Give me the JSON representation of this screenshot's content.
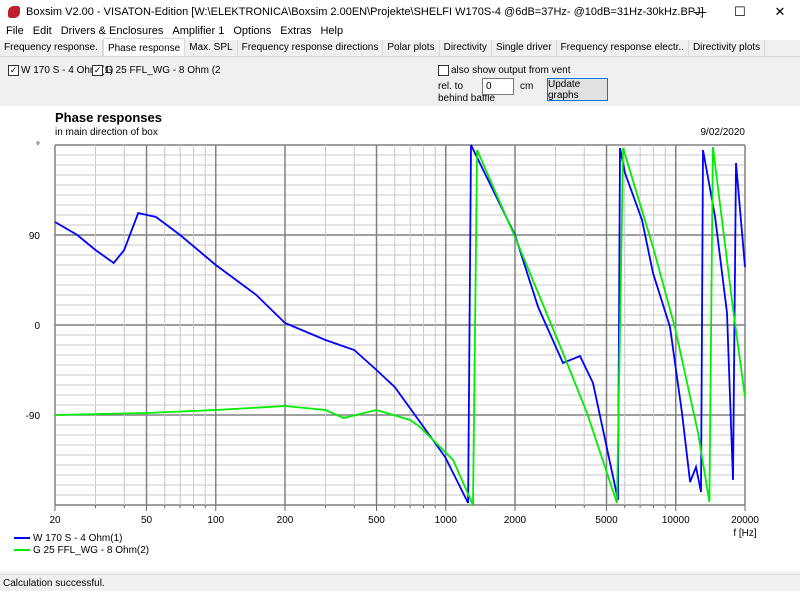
{
  "window": {
    "title": "Boxsim V2.00 - VISATON-Edition [W:\\ELEKTRONICA\\Boxsim 2.00EN\\Projekte\\SHELFI W170S-4 @6dB=37Hz- @10dB=31Hz-30kHz.BPJ]",
    "minimize": "—",
    "maximize": "☐",
    "close": "✕"
  },
  "menu": [
    "File",
    "Edit",
    "Drivers & Enclosures",
    "Amplifier 1",
    "Options",
    "Extras",
    "Help"
  ],
  "tabs": [
    "Frequency response.",
    "Phase response",
    "Max. SPL",
    "Frequency response directions",
    "Polar plots",
    "Directivity",
    "Single driver",
    "Frequency response electr..",
    "Directivity plots"
  ],
  "options": {
    "driver1": "W 170 S - 4 Ohm (1)",
    "driver2": "G 25 FFL_WG - 8 Ohm (2",
    "vent": "also show output from vent",
    "rel_to": "rel. to",
    "behind": "behind baffle",
    "offset": "0",
    "unit": "cm",
    "update": "Update graphs"
  },
  "status": "Calculation successful.",
  "colors": {
    "blue": "#0000ff",
    "green": "#00ee00"
  },
  "chart_data": {
    "type": "line",
    "title": "Phase responses",
    "subtitle": "in main direction of box",
    "date": "9/02/2020",
    "xlabel": "f [Hz]",
    "ylabel": "°",
    "xscale": "log",
    "xlim": [
      20,
      20000
    ],
    "ylim": [
      -180,
      180
    ],
    "xticks": [
      "20",
      "50",
      "100",
      "200",
      "500",
      "1000",
      "2000",
      "5000",
      "10000",
      "20000"
    ],
    "yticks": [
      "90",
      "0",
      "-90"
    ],
    "legend_position": "bottom-left",
    "series": [
      {
        "name": "W 170 S - 4 Ohm(1)",
        "color": "#0000ff",
        "points": [
          [
            20,
            103
          ],
          [
            25,
            90
          ],
          [
            30,
            75
          ],
          [
            36,
            62
          ],
          [
            40,
            75
          ],
          [
            46,
            112
          ],
          [
            55,
            108
          ],
          [
            70,
            90
          ],
          [
            100,
            60
          ],
          [
            150,
            30
          ],
          [
            200,
            2
          ],
          [
            300,
            -15
          ],
          [
            400,
            -25
          ],
          [
            500,
            -45
          ],
          [
            600,
            -62
          ],
          [
            773,
            -97
          ],
          [
            993,
            -132
          ],
          [
            1250,
            -178
          ],
          [
            1288,
            180
          ],
          [
            2000,
            90
          ],
          [
            2520,
            18
          ],
          [
            3234,
            -38
          ],
          [
            3835,
            -31
          ],
          [
            4366,
            -58
          ],
          [
            5610,
            -175
          ],
          [
            5724,
            177
          ],
          [
            6017,
            152
          ],
          [
            7130,
            105
          ],
          [
            7965,
            52
          ],
          [
            9440,
            -2
          ],
          [
            10640,
            -88
          ],
          [
            11540,
            -157
          ],
          [
            12240,
            -142
          ],
          [
            12880,
            -167
          ],
          [
            13130,
            175
          ],
          [
            14820,
            108
          ],
          [
            16700,
            12
          ],
          [
            17740,
            -155
          ],
          [
            18280,
            162
          ],
          [
            20000,
            58
          ]
        ]
      },
      {
        "name": "G 25 FFL_WG - 8 Ohm(2)",
        "color": "#00ee00",
        "points": [
          [
            20,
            -90
          ],
          [
            50,
            -88
          ],
          [
            100,
            -85
          ],
          [
            200,
            -81
          ],
          [
            300,
            -85
          ],
          [
            360,
            -93
          ],
          [
            500,
            -85
          ],
          [
            700,
            -95
          ],
          [
            773,
            -102
          ],
          [
            1076,
            -135
          ],
          [
            1313,
            -180
          ],
          [
            1368,
            175
          ],
          [
            2000,
            88
          ],
          [
            3234,
            -28
          ],
          [
            4112,
            -88
          ],
          [
            5550,
            -178
          ],
          [
            5900,
            177
          ],
          [
            7965,
            78
          ],
          [
            9900,
            -2
          ],
          [
            12500,
            -108
          ],
          [
            14000,
            -177
          ],
          [
            14500,
            178
          ],
          [
            17700,
            18
          ],
          [
            20000,
            -72
          ]
        ]
      }
    ]
  }
}
